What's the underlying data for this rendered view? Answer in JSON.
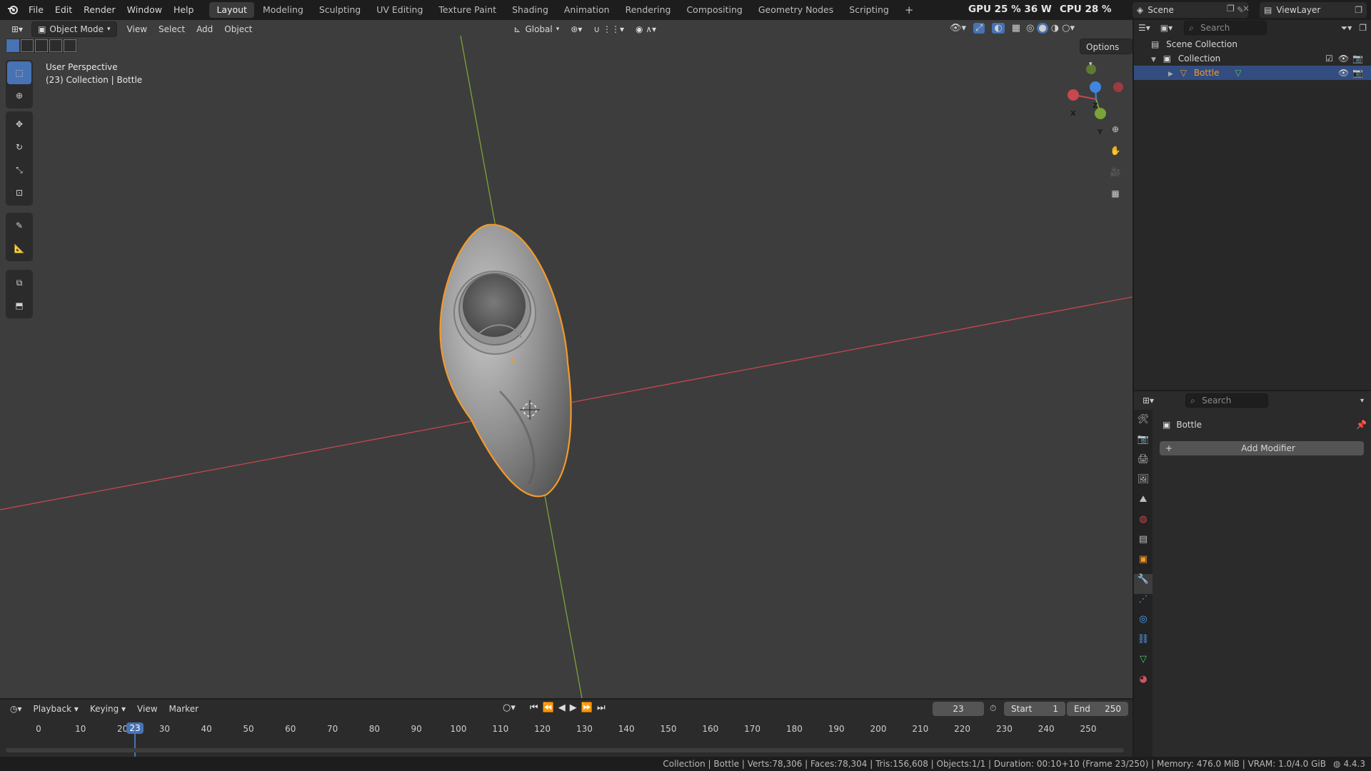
{
  "top_menu": [
    "File",
    "Edit",
    "Render",
    "Window",
    "Help"
  ],
  "workspaces": [
    "Layout",
    "Modeling",
    "Sculpting",
    "UV Editing",
    "Texture Paint",
    "Shading",
    "Animation",
    "Rendering",
    "Compositing",
    "Geometry Nodes",
    "Scripting"
  ],
  "active_workspace": "Layout",
  "add_workspace": "+",
  "gpu_stat": "GPU 25 % 36 W",
  "cpu_stat": "CPU 28 %",
  "scene_name": "Scene",
  "view_layer": "ViewLayer",
  "viewport": {
    "mode": "Object Mode",
    "menus": [
      "View",
      "Select",
      "Add",
      "Object"
    ],
    "orientation": "Global",
    "options": "Options",
    "overlay_line1": "User Perspective",
    "overlay_line2": "(23) Collection | Bottle",
    "axis_labels": {
      "x": "X",
      "y": "Y",
      "z": "Z"
    }
  },
  "outliner": {
    "search_placeholder": "Search",
    "scene_collection": "Scene Collection",
    "collection": "Collection",
    "object": "Bottle"
  },
  "properties": {
    "search_placeholder": "Search",
    "object_name": "Bottle",
    "add_modifier": "Add Modifier"
  },
  "timeline": {
    "menus": [
      "Playback",
      "Keying",
      "View",
      "Marker"
    ],
    "current_frame": "23",
    "start_label": "Start",
    "start_value": "1",
    "end_label": "End",
    "end_value": "250",
    "ticks": [
      "0",
      "10",
      "20",
      "30",
      "40",
      "50",
      "60",
      "70",
      "80",
      "90",
      "100",
      "110",
      "120",
      "130",
      "140",
      "150",
      "160",
      "170",
      "180",
      "190",
      "200",
      "210",
      "220",
      "230",
      "240",
      "250"
    ]
  },
  "status_bar": "Collection | Bottle | Verts:78,306 | Faces:78,304 | Tris:156,608 | Objects:1/1 | Duration: 00:10+10 (Frame 23/250) | Memory: 476.0 MiB | VRAM: 1.0/4.0 GiB",
  "version": "4.4.3",
  "colors": {
    "accent": "#4772b3",
    "selection_outline": "#f39a2b",
    "x_axis": "#c9474f",
    "y_axis": "#7ba33a",
    "z_axis": "#3f86e0"
  }
}
